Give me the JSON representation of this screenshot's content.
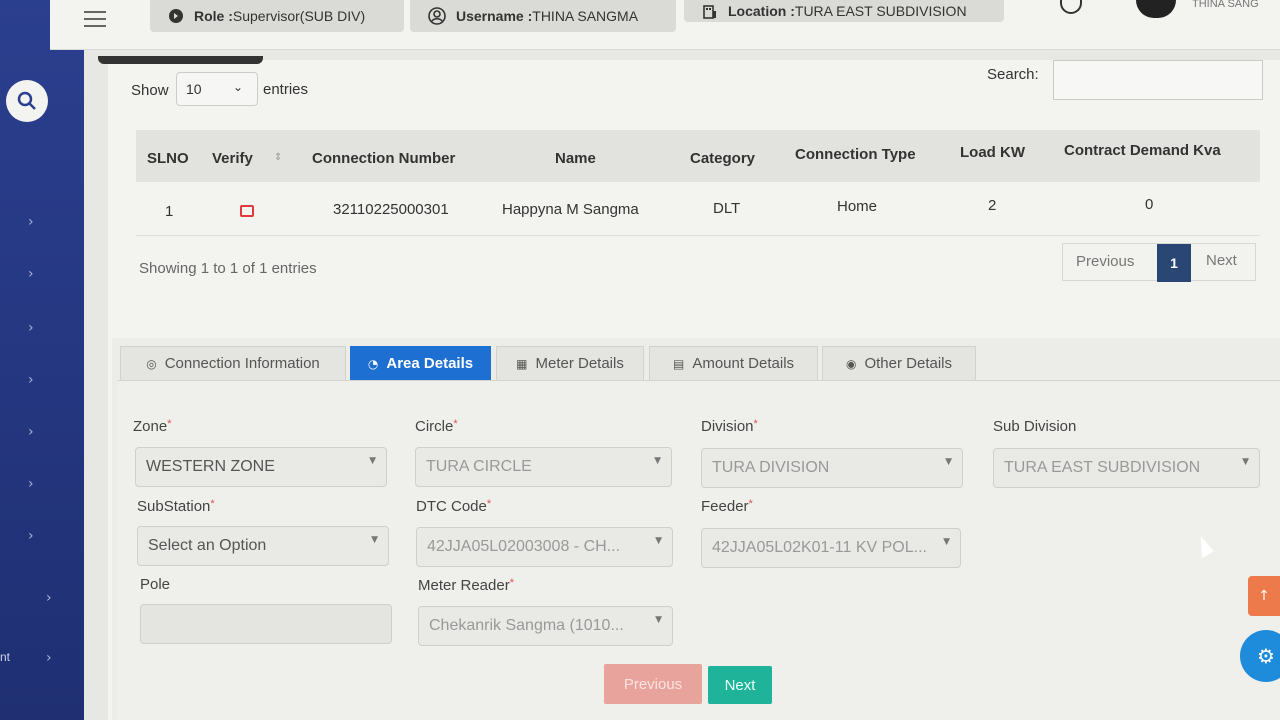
{
  "header": {
    "role_label": "Role :",
    "role_value": "Supervisor(SUB DIV)",
    "username_label": "Username :",
    "username_value": "THINA SANGMA",
    "location_label": "Location :",
    "location_value": "TURA EAST SUBDIVISION",
    "user_name_short": "THINA SANG"
  },
  "table_controls": {
    "show_label": "Show",
    "show_value": "10",
    "entries_label": "entries",
    "search_label": "Search:",
    "search_value": ""
  },
  "table": {
    "columns": [
      "SLNO",
      "Verify",
      "Connection Number",
      "Name",
      "Category",
      "Connection Type",
      "Load KW",
      "Contract Demand Kva"
    ],
    "rows": [
      {
        "slno": "1",
        "connection_number": "32110225000301",
        "name": "Happyna M Sangma",
        "category": "DLT",
        "connection_type": "Home",
        "load_kw": "2",
        "contract_demand": "0"
      }
    ]
  },
  "pagination": {
    "info": "Showing 1 to 1 of 1 entries",
    "previous": "Previous",
    "current": "1",
    "next": "Next"
  },
  "tabs": [
    {
      "label": "Connection Information",
      "icon": "info-circle-icon"
    },
    {
      "label": "Area Details",
      "icon": "area-icon"
    },
    {
      "label": "Meter Details",
      "icon": "meter-icon"
    },
    {
      "label": "Amount Details",
      "icon": "amount-icon"
    },
    {
      "label": "Other Details",
      "icon": "other-icon"
    }
  ],
  "form": {
    "zone": {
      "label": "Zone",
      "value": "WESTERN ZONE"
    },
    "circle": {
      "label": "Circle",
      "value": "TURA CIRCLE"
    },
    "division": {
      "label": "Division",
      "value": "TURA DIVISION"
    },
    "sub_division": {
      "label": "Sub Division",
      "value": "TURA EAST SUBDIVISION"
    },
    "substation": {
      "label": "SubStation",
      "value": "Select an Option"
    },
    "dtc_code": {
      "label": "DTC Code",
      "value": "42JJA05L02003008 - CH..."
    },
    "feeder": {
      "label": "Feeder",
      "value": "42JJA05L02K01-11 KV POL..."
    },
    "pole": {
      "label": "Pole",
      "value": ""
    },
    "meter_reader": {
      "label": "Meter Reader",
      "value": "Chekanrik Sangma (1010..."
    }
  },
  "buttons": {
    "previous": "Previous",
    "next": "Next"
  },
  "sidebar": {
    "bottom_label": "nt"
  },
  "colors": {
    "sidebar": "#2b3f8f",
    "active_tab": "#1d6fd1",
    "next_button": "#1fb39a",
    "previous_button": "#e8a39c",
    "page_current": "#2a4674"
  }
}
